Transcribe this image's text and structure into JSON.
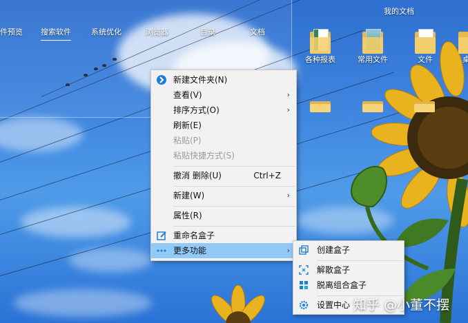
{
  "fence": {
    "tabs": [
      "件预览",
      "搜索软件",
      "系统优化",
      "浏览器",
      "目录",
      "文档"
    ],
    "active_tab": 1,
    "title": "我的文档"
  },
  "desktop_icons": [
    {
      "label": "各种报表",
      "icon": "spreadsheet-folder-icon"
    },
    {
      "label": "常用文件",
      "icon": "photo-folder-icon"
    },
    {
      "label": "文件",
      "icon": "folder-icon"
    },
    {
      "label": "桌",
      "icon": "folder-icon"
    }
  ],
  "context_menu": {
    "items": [
      {
        "label": "新建文件夹(N)",
        "icon": "new-folder-icon"
      },
      {
        "label": "查看(V)",
        "arrow": "›"
      },
      {
        "label": "排序方式(O)",
        "arrow": "›"
      },
      {
        "label": "刷新(E)"
      },
      {
        "label": "粘贴(P)",
        "disabled": true
      },
      {
        "label": "粘贴快捷方式(S)",
        "disabled": true
      },
      {
        "label": "撤消 删除(U)",
        "shortcut": "Ctrl+Z"
      },
      {
        "label": "新建(W)",
        "arrow": "›"
      },
      {
        "label": "属性(R)"
      },
      {
        "label": "重命名盒子",
        "icon": "edit-icon"
      },
      {
        "label": "更多功能",
        "icon": "more-icon",
        "arrow": "›",
        "highlighted": true
      }
    ]
  },
  "submenu": {
    "items": [
      {
        "label": "创建盒子",
        "icon": "create-box-icon"
      },
      {
        "label": "解散盒子",
        "icon": "dissolve-box-icon"
      },
      {
        "label": "脱离组合盒子",
        "icon": "ungroup-box-icon"
      },
      {
        "label": "设置中心",
        "icon": "gear-icon"
      }
    ]
  },
  "watermark": "知乎 @小董不摆",
  "colors": {
    "menu_bg": "#f2f2f2",
    "highlight": "#91c9f7",
    "accent_blue": "#1f7fd6",
    "sky": "#3f86e0",
    "petal": "#e9b21f"
  }
}
